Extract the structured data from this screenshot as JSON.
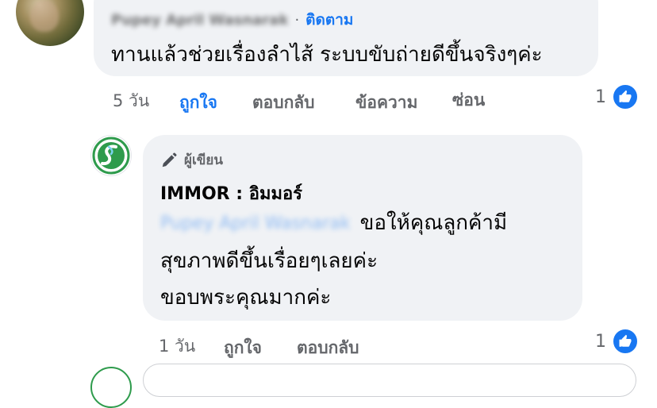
{
  "comment1": {
    "author": "Pupey April Wasnarak",
    "separator": "·",
    "follow_label": "ติดตาม",
    "text": "ทานแล้วช่วยเรื่องลำไส้ ระบบขับถ่ายดีขึ้นจริงๆค่ะ",
    "time": "5 วัน",
    "like_label": "ถูกใจ",
    "reply_label": "ตอบกลับ",
    "message_label": "ข้อความ",
    "hide_label": "ซ่อน",
    "reaction_count": "1"
  },
  "reply1": {
    "badge_label": "ผู้เขียน",
    "author": "IMMOR : อิมมอร์",
    "mention": "Pupey April Wasnarak",
    "text_line1": "ขอให้คุณลูกค้ามี",
    "text_line2": "สุขภาพดีขึ้นเรื่อยๆเลยค่ะ",
    "text_line3": "ขอบพระคุณมากค่ะ",
    "time": "1 วัน",
    "like_label": "ถูกใจ",
    "reply_label": "ตอบกลับ",
    "reaction_count": "1"
  },
  "colors": {
    "facebook_blue": "#1877f2",
    "bubble_bg": "#f0f2f5",
    "meta_gray": "#65676b",
    "brand_green": "#2e9b4c"
  },
  "icons": {
    "like": "thumbs-up-icon",
    "author_badge": "pen-icon",
    "brand_logo": "leaf-s-logo-icon"
  }
}
